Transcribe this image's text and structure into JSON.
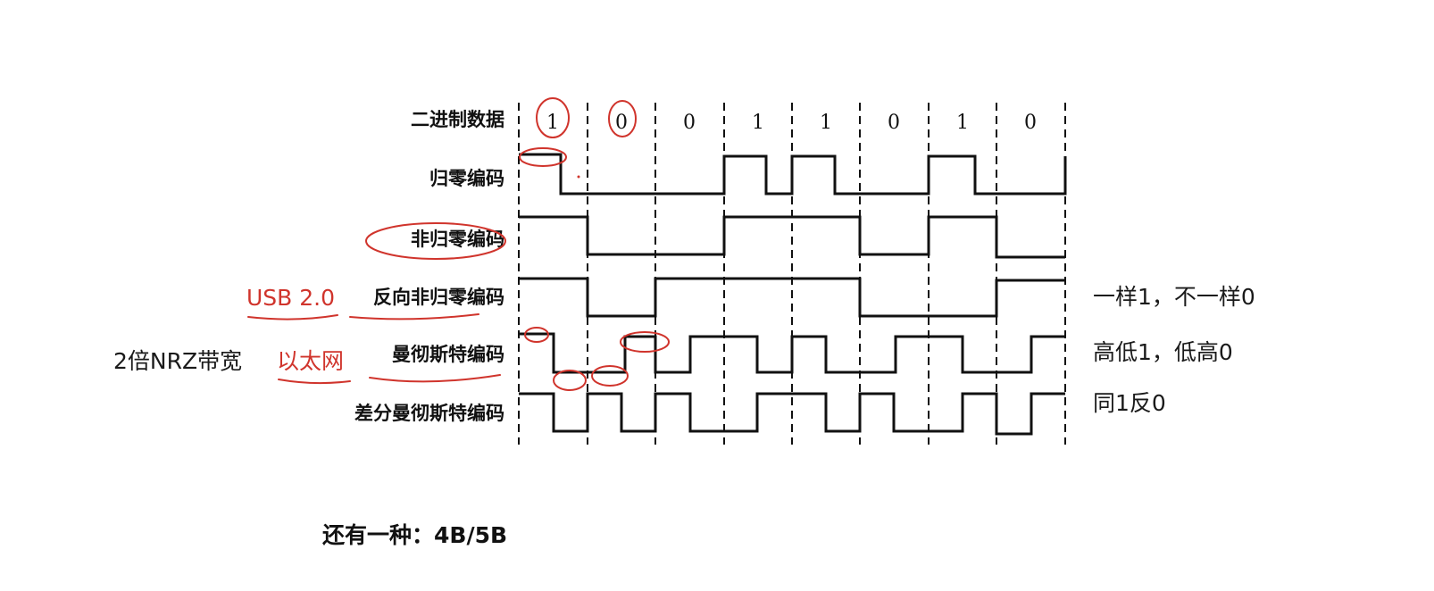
{
  "bits": [
    "1",
    "0",
    "0",
    "1",
    "1",
    "0",
    "1",
    "0"
  ],
  "rows": [
    {
      "id": "binary",
      "label": "二进制数据"
    },
    {
      "id": "rz",
      "label": "归零编码"
    },
    {
      "id": "nrz",
      "label": "非归零编码"
    },
    {
      "id": "nrzi",
      "label": "反向非归零编码"
    },
    {
      "id": "manchester",
      "label": "曼彻斯特编码"
    },
    {
      "id": "diff_manchester",
      "label": "差分曼彻斯特编码"
    }
  ],
  "annotations": {
    "usb": "USB 2.0",
    "bandwidth": "2倍NRZ带宽",
    "ethernet": "以太网"
  },
  "notes": {
    "nrzi": "一样1，不一样0",
    "manchester": "高低1，低高0",
    "diff_manchester": "同1反0"
  },
  "footer": "还有一种：4B/5B",
  "colors": {
    "ink": "#111111",
    "annotation": "#d0342c"
  }
}
